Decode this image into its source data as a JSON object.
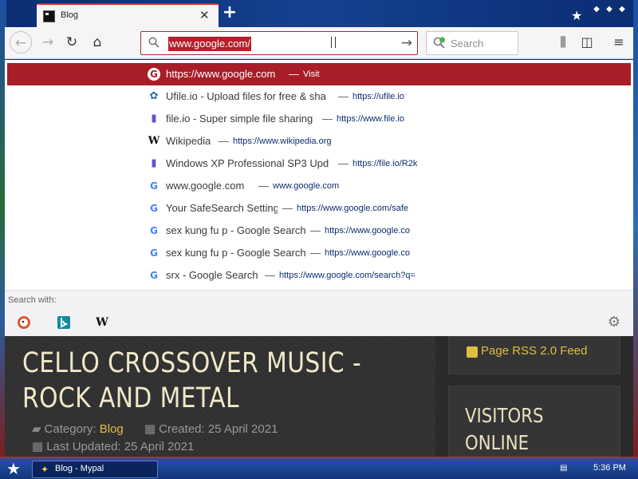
{
  "tab": {
    "title": "Blog",
    "close": "✕",
    "new_tab": "+"
  },
  "navbar": {
    "back": "←",
    "forward": "→",
    "reload": "↻",
    "home": "⌂",
    "url_value": "www.google.com/",
    "go": "→",
    "search_placeholder": "Search",
    "library": "⫼",
    "sidebar": "◫",
    "menu": "≡"
  },
  "suggestions": [
    {
      "icon": "google-icon",
      "title": "https://www.google.com",
      "url": "Visit",
      "selected": true
    },
    {
      "icon": "ufile-icon",
      "title": "Ufile.io - Upload files for free & sha",
      "url": "https://ufile.io"
    },
    {
      "icon": "fileio-icon",
      "title": "file.io - Super simple file sharing",
      "url": "https://www.file.io"
    },
    {
      "icon": "wikipedia-icon",
      "title": "Wikipedia",
      "url": "https://www.wikipedia.org"
    },
    {
      "icon": "fileio-icon",
      "title": "Windows XP Professional SP3 Upd",
      "url": "https://file.io/R2k"
    },
    {
      "icon": "google-icon",
      "title": "www.google.com",
      "url": "www.google.com"
    },
    {
      "icon": "google-icon",
      "title": "Your SafeSearch Setting",
      "url": "https://www.google.com/safe"
    },
    {
      "icon": "google-icon",
      "title": "sex kung fu p - Google Search",
      "url": "https://www.google.co"
    },
    {
      "icon": "google-icon",
      "title": "sex kung fu p - Google Search",
      "url": "https://www.google.co"
    },
    {
      "icon": "google-icon",
      "title": "srx - Google Search",
      "url": "https://www.google.com/search?q="
    }
  ],
  "dash": "—",
  "search_with": {
    "label": "Search with:",
    "engines": [
      "duckduckgo-icon",
      "bing-icon",
      "wikipedia-icon"
    ],
    "wiki_glyph": "W",
    "gear": "⚙"
  },
  "page": {
    "title": "CELLO CROSSOVER MUSIC - ROCK AND METAL",
    "category_label": "Category: ",
    "category_value": "Blog",
    "created": "Created: 25 April 2021",
    "updated": "Last Updated: 25 April 2021",
    "rss": "Page RSS 2.0 Feed",
    "visitors": "VISITORS ONLINE"
  },
  "taskbar": {
    "task_label": "Blog - Mypal",
    "clock": "5:36 PM"
  },
  "colors": {
    "accent": "#a81d27",
    "link_gold": "#e2bd43",
    "taskbar": "#12357a"
  }
}
